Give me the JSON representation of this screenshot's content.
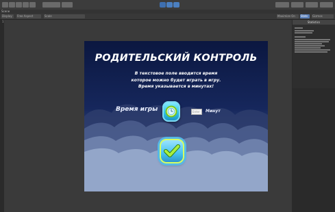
{
  "editor": {
    "tab_label": "Scene",
    "subbar": {
      "items": [
        "Display 1",
        "Free Aspect",
        "Scale",
        "Maximize On Play",
        "Stats",
        "Gizmos"
      ]
    },
    "stats": {
      "title": "Statistics"
    }
  },
  "game": {
    "title": "РОДИТЕЛЬСКИЙ КОНТРОЛЬ",
    "description_lines": [
      "В текстовое поле вводится время",
      "которое можно будет играть в игру.",
      "Время указывается в минутах!"
    ],
    "time_label": "Время игры",
    "time_input_placeholder": "Enter",
    "minutes_label": "Минут",
    "clock_icon": "clock-icon",
    "ok_icon": "checkmark-icon"
  },
  "colors": {
    "sky_top": "#0b1740",
    "sky_bottom": "#9cb0d0",
    "button_accent": "#46c2ef",
    "check_green": "#9be23a"
  }
}
